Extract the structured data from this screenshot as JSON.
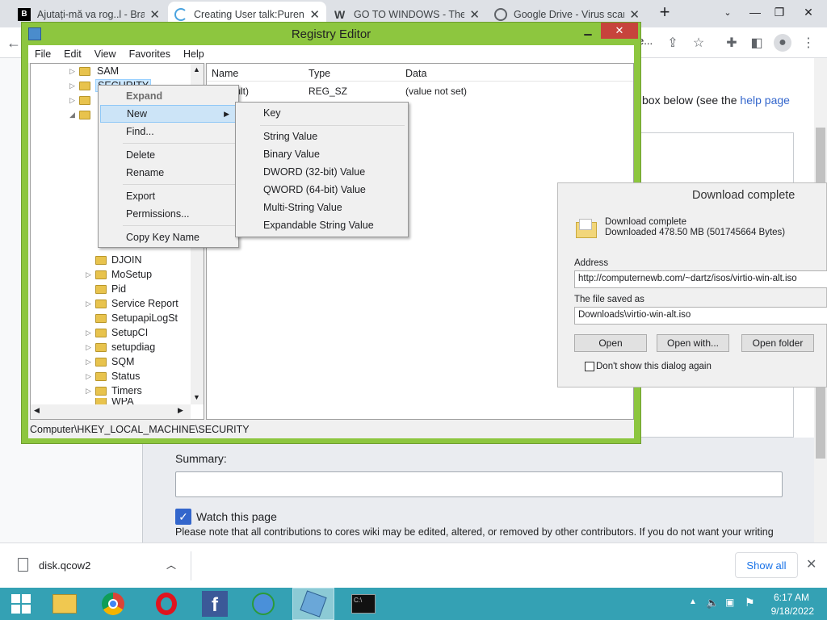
{
  "browser": {
    "tabs": [
      {
        "title": "Ajutați-mă va rog..l - Brai"
      },
      {
        "title": "Creating User talk:Purene"
      },
      {
        "title": "GO TO WINDOWS - The"
      },
      {
        "title": "Google Drive - Virus scar"
      }
    ],
    "url_fragment": "e..."
  },
  "wiki": {
    "help_text": "box below (see the",
    "help_link": "help page",
    "summary_label": "Summary:",
    "watch_label": "Watch this page",
    "notice": "Please note that all contributions to cores wiki may be edited, altered, or removed by other contributors. If you do not want your writing"
  },
  "regedit": {
    "title": "Registry Editor",
    "menu": [
      "File",
      "Edit",
      "View",
      "Favorites",
      "Help"
    ],
    "tree": [
      "SAM",
      "SECURITY",
      "DJOIN",
      "MoSetup",
      "Pid",
      "Service Report",
      "SetupapiLogSt",
      "SetupCI",
      "setupdiag",
      "SQM",
      "Status",
      "Timers",
      "WPA"
    ],
    "columns": {
      "name": "Name",
      "type": "Type",
      "data": "Data"
    },
    "row": {
      "name": "(Default)",
      "type": "REG_SZ",
      "data": "(value not set)"
    },
    "status": "Computer\\HKEY_LOCAL_MACHINE\\SECURITY"
  },
  "context_menu": {
    "items": [
      "Expand",
      "New",
      "Find...",
      "Delete",
      "Rename",
      "Export",
      "Permissions...",
      "Copy Key Name"
    ]
  },
  "submenu": {
    "items": [
      "Key",
      "String Value",
      "Binary Value",
      "DWORD (32-bit) Value",
      "QWORD (64-bit) Value",
      "Multi-String Value",
      "Expandable String Value"
    ]
  },
  "download_dialog": {
    "title": "Download complete",
    "heading": "Download complete",
    "size": "Downloaded 478.50  MB (501745664 Bytes)",
    "address_label": "Address",
    "address": "http://computernewb.com/~dartz/isos/virtio-win-alt.iso",
    "saved_label": "The file saved as",
    "saved": "Downloads\\virtio-win-alt.iso",
    "open": "Open",
    "open_with": "Open with...",
    "open_folder": "Open folder",
    "dont_show": "Don't show this dialog again"
  },
  "shelf": {
    "file": "disk.qcow2",
    "show_all": "Show all"
  },
  "taskbar": {
    "time": "6:17 AM",
    "date": "9/18/2022"
  }
}
